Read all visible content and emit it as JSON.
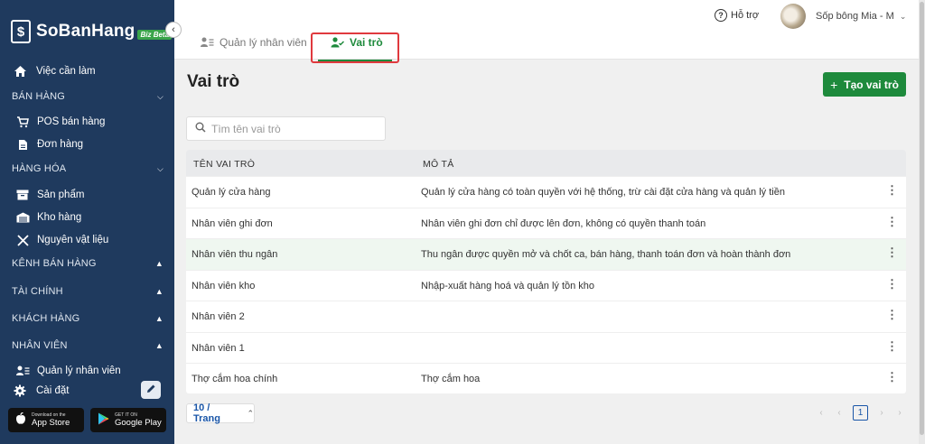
{
  "brand": {
    "name": "SoBanHang",
    "badge": "Biz Beta"
  },
  "sidebar": {
    "todo": "Việc cần làm",
    "sections": {
      "ban_hang": "BÁN HÀNG",
      "hang_hoa": "HÀNG HÓA",
      "kenh_ban_hang": "KÊNH BÁN HÀNG",
      "tai_chinh": "TÀI CHÍNH",
      "khach_hang": "KHÁCH HÀNG",
      "nhan_vien": "NHÂN VIÊN"
    },
    "items": {
      "pos": "POS bán hàng",
      "orders": "Đơn hàng",
      "products": "Sản phẩm",
      "warehouse": "Kho hàng",
      "materials": "Nguyên vật liệu",
      "staff_mgmt": "Quản lý nhân viên",
      "settings": "Cài đặt"
    },
    "stores": {
      "appstore_small": "Download on the",
      "appstore": "App Store",
      "googleplay_small": "GET IT ON",
      "googleplay": "Google Play"
    }
  },
  "header": {
    "help": "Hỗ trợ",
    "user_name": "Sốp bông Mia - M"
  },
  "tabs": {
    "staff": "Quản lý nhân viên",
    "roles": "Vai trò"
  },
  "page": {
    "title": "Vai trò",
    "create_button": "Tạo vai trò",
    "search_placeholder": "Tìm tên vai trò"
  },
  "table": {
    "headers": {
      "name": "TÊN VAI TRÒ",
      "desc": "MÔ TẢ"
    },
    "rows": [
      {
        "name": "Quản lý cửa hàng",
        "desc": "Quản lý cửa hàng có toàn quyền với hệ thống, trừ cài đặt cửa hàng và quản lý tiền"
      },
      {
        "name": "Nhân viên ghi đơn",
        "desc": "Nhân viên ghi đơn chỉ được lên đơn, không có quyền thanh toán"
      },
      {
        "name": "Nhân viên thu ngân",
        "desc": "Thu ngân được quyền mở và chốt ca, bán hàng, thanh toán đơn và hoàn thành đơn"
      },
      {
        "name": "Nhân viên kho",
        "desc": "Nhập-xuất hàng hoá và quản lý tồn kho"
      },
      {
        "name": "Nhân viên 2",
        "desc": ""
      },
      {
        "name": "Nhân viên 1",
        "desc": ""
      },
      {
        "name": "Thợ cắm hoa chính",
        "desc": "Thợ cắm hoa"
      }
    ]
  },
  "pagination": {
    "page_size": "10 / Trang",
    "current_page": "1"
  },
  "colors": {
    "sidebar": "#1f3a5e",
    "accent": "#1e8a3c",
    "highlight": "#e0393e",
    "link": "#1a56a8"
  }
}
